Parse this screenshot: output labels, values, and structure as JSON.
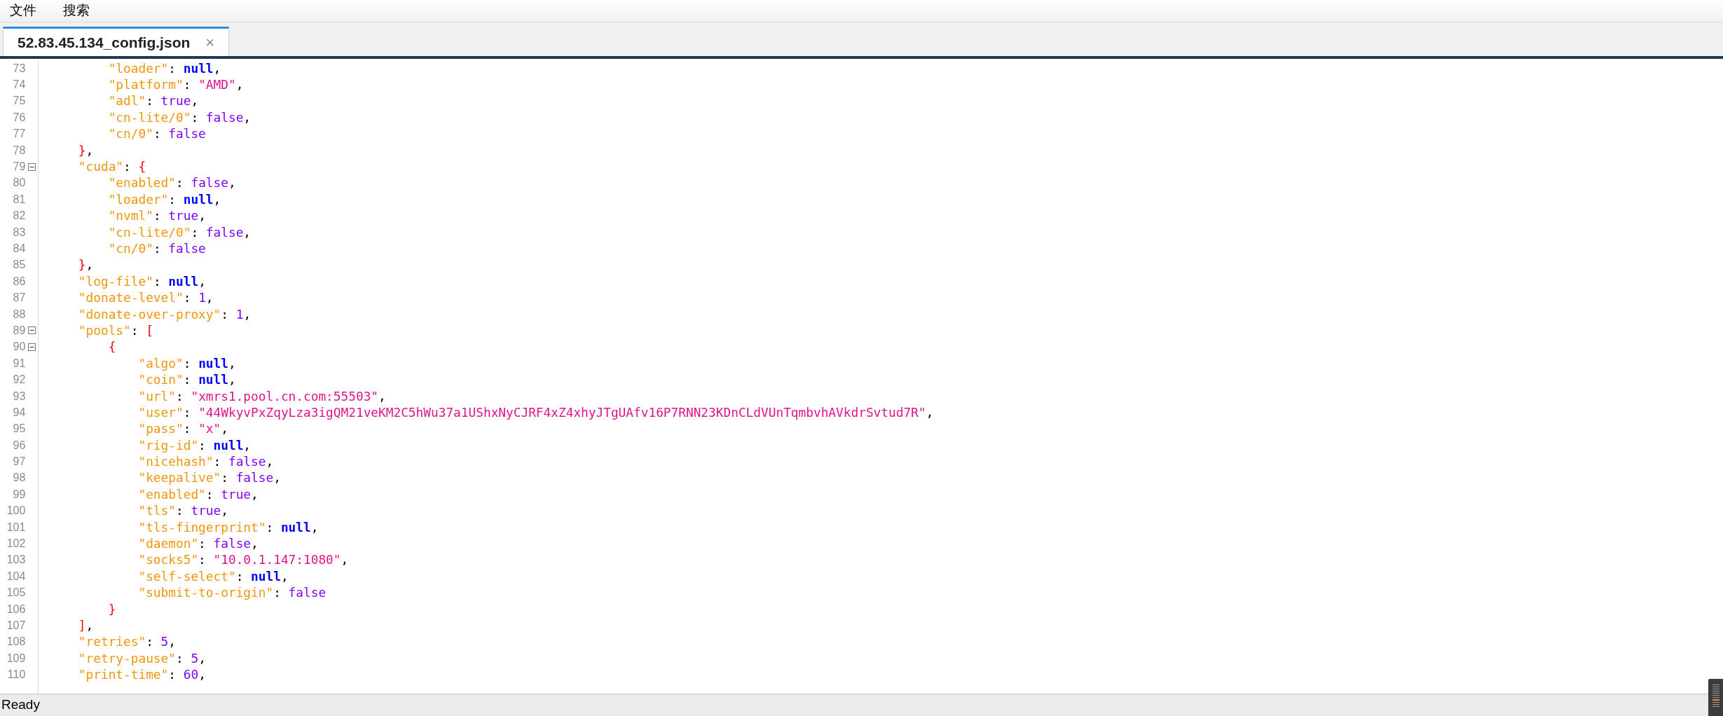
{
  "menu": [
    "文件",
    "搜索"
  ],
  "tabs": [
    {
      "label": "52.83.45.134_config.json",
      "close": "×",
      "selected": true
    }
  ],
  "editor": {
    "lines": [
      {
        "number": "73",
        "fold": false,
        "tokens": [
          {
            "kind": "key",
            "text": "        \"loader\""
          },
          {
            "kind": "punct",
            "text": ": "
          },
          {
            "kind": "null",
            "text": "null"
          },
          {
            "kind": "punct",
            "text": ","
          }
        ]
      },
      {
        "number": "74",
        "fold": false,
        "tokens": [
          {
            "kind": "key",
            "text": "        \"platform\""
          },
          {
            "kind": "punct",
            "text": ": "
          },
          {
            "kind": "string",
            "text": "\"AMD\""
          },
          {
            "kind": "punct",
            "text": ","
          }
        ]
      },
      {
        "number": "75",
        "fold": false,
        "tokens": [
          {
            "kind": "key",
            "text": "        \"adl\""
          },
          {
            "kind": "punct",
            "text": ": "
          },
          {
            "kind": "literal",
            "text": "true"
          },
          {
            "kind": "punct",
            "text": ","
          }
        ]
      },
      {
        "number": "76",
        "fold": false,
        "tokens": [
          {
            "kind": "key",
            "text": "        \"cn-lite/0\""
          },
          {
            "kind": "punct",
            "text": ": "
          },
          {
            "kind": "literal",
            "text": "false"
          },
          {
            "kind": "punct",
            "text": ","
          }
        ]
      },
      {
        "number": "77",
        "fold": false,
        "tokens": [
          {
            "kind": "key",
            "text": "        \"cn/0\""
          },
          {
            "kind": "punct",
            "text": ": "
          },
          {
            "kind": "literal",
            "text": "false"
          }
        ]
      },
      {
        "number": "78",
        "fold": false,
        "tokens": [
          {
            "kind": "bracket",
            "text": "    }"
          },
          {
            "kind": "punct",
            "text": ","
          }
        ]
      },
      {
        "number": "79",
        "fold": true,
        "tokens": [
          {
            "kind": "key",
            "text": "    \"cuda\""
          },
          {
            "kind": "punct",
            "text": ": "
          },
          {
            "kind": "bracket",
            "text": "{"
          }
        ]
      },
      {
        "number": "80",
        "fold": false,
        "tokens": [
          {
            "kind": "key",
            "text": "        \"enabled\""
          },
          {
            "kind": "punct",
            "text": ": "
          },
          {
            "kind": "literal",
            "text": "false"
          },
          {
            "kind": "punct",
            "text": ","
          }
        ]
      },
      {
        "number": "81",
        "fold": false,
        "tokens": [
          {
            "kind": "key",
            "text": "        \"loader\""
          },
          {
            "kind": "punct",
            "text": ": "
          },
          {
            "kind": "null",
            "text": "null"
          },
          {
            "kind": "punct",
            "text": ","
          }
        ]
      },
      {
        "number": "82",
        "fold": false,
        "tokens": [
          {
            "kind": "key",
            "text": "        \"nvml\""
          },
          {
            "kind": "punct",
            "text": ": "
          },
          {
            "kind": "literal",
            "text": "true"
          },
          {
            "kind": "punct",
            "text": ","
          }
        ]
      },
      {
        "number": "83",
        "fold": false,
        "tokens": [
          {
            "kind": "key",
            "text": "        \"cn-lite/0\""
          },
          {
            "kind": "punct",
            "text": ": "
          },
          {
            "kind": "literal",
            "text": "false"
          },
          {
            "kind": "punct",
            "text": ","
          }
        ]
      },
      {
        "number": "84",
        "fold": false,
        "tokens": [
          {
            "kind": "key",
            "text": "        \"cn/0\""
          },
          {
            "kind": "punct",
            "text": ": "
          },
          {
            "kind": "literal",
            "text": "false"
          }
        ]
      },
      {
        "number": "85",
        "fold": false,
        "tokens": [
          {
            "kind": "bracket",
            "text": "    }"
          },
          {
            "kind": "punct",
            "text": ","
          }
        ]
      },
      {
        "number": "86",
        "fold": false,
        "tokens": [
          {
            "kind": "key",
            "text": "    \"log-file\""
          },
          {
            "kind": "punct",
            "text": ": "
          },
          {
            "kind": "null",
            "text": "null"
          },
          {
            "kind": "punct",
            "text": ","
          }
        ]
      },
      {
        "number": "87",
        "fold": false,
        "tokens": [
          {
            "kind": "key",
            "text": "    \"donate-level\""
          },
          {
            "kind": "punct",
            "text": ": "
          },
          {
            "kind": "literal",
            "text": "1"
          },
          {
            "kind": "punct",
            "text": ","
          }
        ]
      },
      {
        "number": "88",
        "fold": false,
        "tokens": [
          {
            "kind": "key",
            "text": "    \"donate-over-proxy\""
          },
          {
            "kind": "punct",
            "text": ": "
          },
          {
            "kind": "literal",
            "text": "1"
          },
          {
            "kind": "punct",
            "text": ","
          }
        ]
      },
      {
        "number": "89",
        "fold": true,
        "tokens": [
          {
            "kind": "key",
            "text": "    \"pools\""
          },
          {
            "kind": "punct",
            "text": ": "
          },
          {
            "kind": "bracket",
            "text": "["
          }
        ]
      },
      {
        "number": "90",
        "fold": true,
        "tokens": [
          {
            "kind": "bracket",
            "text": "        {"
          }
        ]
      },
      {
        "number": "91",
        "fold": false,
        "tokens": [
          {
            "kind": "key",
            "text": "            \"algo\""
          },
          {
            "kind": "punct",
            "text": ": "
          },
          {
            "kind": "null",
            "text": "null"
          },
          {
            "kind": "punct",
            "text": ","
          }
        ]
      },
      {
        "number": "92",
        "fold": false,
        "tokens": [
          {
            "kind": "key",
            "text": "            \"coin\""
          },
          {
            "kind": "punct",
            "text": ": "
          },
          {
            "kind": "null",
            "text": "null"
          },
          {
            "kind": "punct",
            "text": ","
          }
        ]
      },
      {
        "number": "93",
        "fold": false,
        "tokens": [
          {
            "kind": "key",
            "text": "            \"url\""
          },
          {
            "kind": "punct",
            "text": ": "
          },
          {
            "kind": "string",
            "text": "\"xmrs1.pool.cn.com:55503\""
          },
          {
            "kind": "punct",
            "text": ","
          }
        ]
      },
      {
        "number": "94",
        "fold": false,
        "tokens": [
          {
            "kind": "key",
            "text": "            \"user\""
          },
          {
            "kind": "punct",
            "text": ": "
          },
          {
            "kind": "string",
            "text": "\"44WkyvPxZqyLza3igQM21veKM2C5hWu37a1UShxNyCJRF4xZ4xhyJTgUAfv16P7RNN23KDnCLdVUnTqmbvhAVkdrSvtud7R\""
          },
          {
            "kind": "punct",
            "text": ","
          }
        ]
      },
      {
        "number": "95",
        "fold": false,
        "tokens": [
          {
            "kind": "key",
            "text": "            \"pass\""
          },
          {
            "kind": "punct",
            "text": ": "
          },
          {
            "kind": "string",
            "text": "\"x\""
          },
          {
            "kind": "punct",
            "text": ","
          }
        ]
      },
      {
        "number": "96",
        "fold": false,
        "tokens": [
          {
            "kind": "key",
            "text": "            \"rig-id\""
          },
          {
            "kind": "punct",
            "text": ": "
          },
          {
            "kind": "null",
            "text": "null"
          },
          {
            "kind": "punct",
            "text": ","
          }
        ]
      },
      {
        "number": "97",
        "fold": false,
        "tokens": [
          {
            "kind": "key",
            "text": "            \"nicehash\""
          },
          {
            "kind": "punct",
            "text": ": "
          },
          {
            "kind": "literal",
            "text": "false"
          },
          {
            "kind": "punct",
            "text": ","
          }
        ]
      },
      {
        "number": "98",
        "fold": false,
        "tokens": [
          {
            "kind": "key",
            "text": "            \"keepalive\""
          },
          {
            "kind": "punct",
            "text": ": "
          },
          {
            "kind": "literal",
            "text": "false"
          },
          {
            "kind": "punct",
            "text": ","
          }
        ]
      },
      {
        "number": "99",
        "fold": false,
        "tokens": [
          {
            "kind": "key",
            "text": "            \"enabled\""
          },
          {
            "kind": "punct",
            "text": ": "
          },
          {
            "kind": "literal",
            "text": "true"
          },
          {
            "kind": "punct",
            "text": ","
          }
        ]
      },
      {
        "number": "100",
        "fold": false,
        "tokens": [
          {
            "kind": "key",
            "text": "            \"tls\""
          },
          {
            "kind": "punct",
            "text": ": "
          },
          {
            "kind": "literal",
            "text": "true"
          },
          {
            "kind": "punct",
            "text": ","
          }
        ]
      },
      {
        "number": "101",
        "fold": false,
        "tokens": [
          {
            "kind": "key",
            "text": "            \"tls-fingerprint\""
          },
          {
            "kind": "punct",
            "text": ": "
          },
          {
            "kind": "null",
            "text": "null"
          },
          {
            "kind": "punct",
            "text": ","
          }
        ]
      },
      {
        "number": "102",
        "fold": false,
        "tokens": [
          {
            "kind": "key",
            "text": "            \"daemon\""
          },
          {
            "kind": "punct",
            "text": ": "
          },
          {
            "kind": "literal",
            "text": "false"
          },
          {
            "kind": "punct",
            "text": ","
          }
        ]
      },
      {
        "number": "103",
        "fold": false,
        "tokens": [
          {
            "kind": "key",
            "text": "            \"socks5\""
          },
          {
            "kind": "punct",
            "text": ": "
          },
          {
            "kind": "string",
            "text": "\"10.0.1.147:1080\""
          },
          {
            "kind": "punct",
            "text": ","
          }
        ]
      },
      {
        "number": "104",
        "fold": false,
        "tokens": [
          {
            "kind": "key",
            "text": "            \"self-select\""
          },
          {
            "kind": "punct",
            "text": ": "
          },
          {
            "kind": "null",
            "text": "null"
          },
          {
            "kind": "punct",
            "text": ","
          }
        ]
      },
      {
        "number": "105",
        "fold": false,
        "tokens": [
          {
            "kind": "key",
            "text": "            \"submit-to-origin\""
          },
          {
            "kind": "punct",
            "text": ": "
          },
          {
            "kind": "literal",
            "text": "false"
          }
        ]
      },
      {
        "number": "106",
        "fold": false,
        "tokens": [
          {
            "kind": "bracket",
            "text": "        }"
          }
        ]
      },
      {
        "number": "107",
        "fold": false,
        "tokens": [
          {
            "kind": "bracket",
            "text": "    ]"
          },
          {
            "kind": "punct",
            "text": ","
          }
        ]
      },
      {
        "number": "108",
        "fold": false,
        "tokens": [
          {
            "kind": "key",
            "text": "    \"retries\""
          },
          {
            "kind": "punct",
            "text": ": "
          },
          {
            "kind": "literal",
            "text": "5"
          },
          {
            "kind": "punct",
            "text": ","
          }
        ]
      },
      {
        "number": "109",
        "fold": false,
        "tokens": [
          {
            "kind": "key",
            "text": "    \"retry-pause\""
          },
          {
            "kind": "punct",
            "text": ": "
          },
          {
            "kind": "literal",
            "text": "5"
          },
          {
            "kind": "punct",
            "text": ","
          }
        ]
      },
      {
        "number": "110",
        "fold": false,
        "tokens": [
          {
            "kind": "key",
            "text": "    \"print-time\""
          },
          {
            "kind": "punct",
            "text": ": "
          },
          {
            "kind": "literal",
            "text": "60"
          },
          {
            "kind": "punct",
            "text": ","
          }
        ]
      }
    ]
  },
  "status_bar": {
    "text": "Ready"
  }
}
